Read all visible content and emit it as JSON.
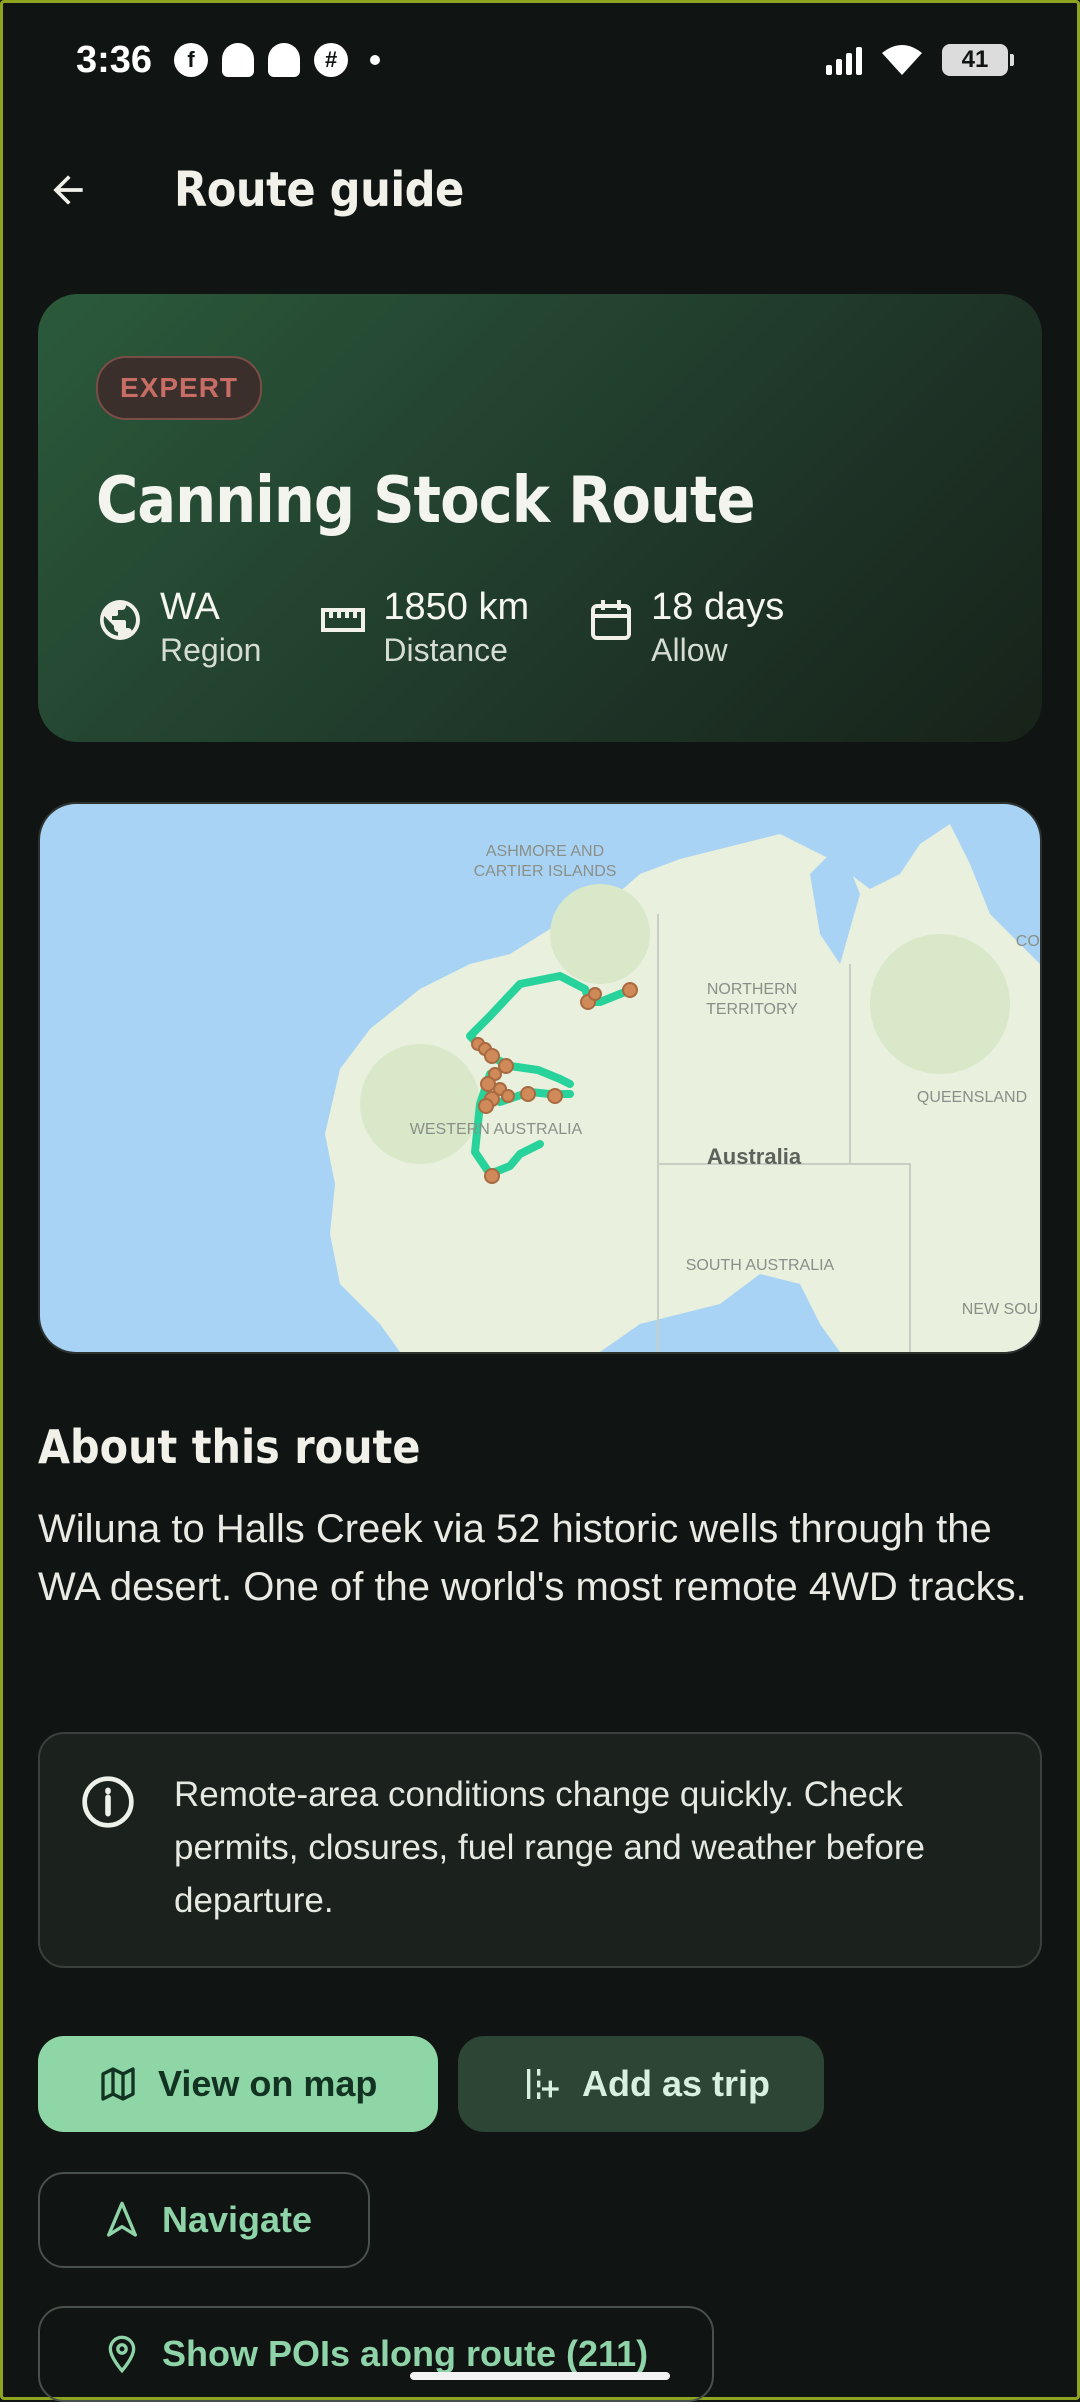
{
  "status_bar": {
    "time": "3:36",
    "notification_icons": [
      "facebook-icon",
      "snapchat-icon",
      "snapchat-icon",
      "app-icon"
    ],
    "battery": "41"
  },
  "appbar": {
    "title": "Route guide"
  },
  "route": {
    "difficulty": "EXPERT",
    "name": "Canning Stock Route",
    "stats": [
      {
        "icon": "globe-icon",
        "value": "WA",
        "label": "Region"
      },
      {
        "icon": "ruler-icon",
        "value": "1850 km",
        "label": "Distance"
      },
      {
        "icon": "calendar-icon",
        "value": "18 days",
        "label": "Allow"
      }
    ]
  },
  "map": {
    "labels": {
      "ashmore1": "ASHMORE AND",
      "ashmore2": "CARTIER ISLANDS",
      "nt1": "NORTHERN",
      "nt2": "TERRITORY",
      "qld": "QUEENSLAND",
      "wa": "WESTERN AUSTRALIA",
      "aus": "Australia",
      "sa": "SOUTH AUSTRALIA",
      "nsw": "NEW SOU",
      "coral": "COI"
    },
    "colors": {
      "water": "#a9d3f5",
      "land": "#e9f0de",
      "route": "#27d39a",
      "poi": "#d08a5a"
    }
  },
  "about": {
    "heading": "About this route",
    "text": "Wiluna to Halls Creek via 52 historic wells through the WA desert. One of the world's most remote 4WD tracks."
  },
  "notice": {
    "text": "Remote-area conditions change quickly. Check permits, closures, fuel range and weather before departure."
  },
  "actions": {
    "view_on_map": "View on map",
    "add_as_trip": "Add as trip",
    "navigate": "Navigate",
    "show_pois": "Show POIs along route (211)"
  }
}
